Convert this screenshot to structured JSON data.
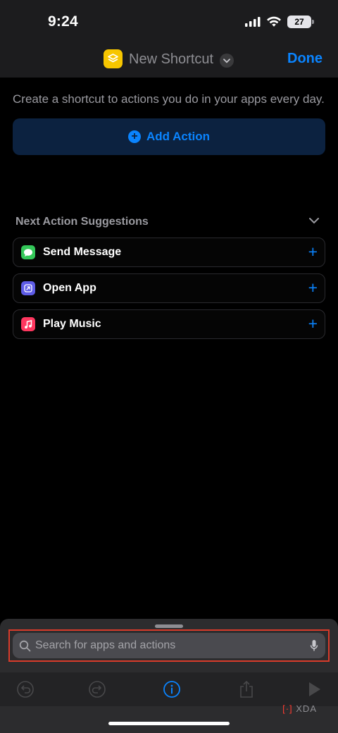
{
  "status_bar": {
    "time": "9:24",
    "battery": "27"
  },
  "nav": {
    "title": "New Shortcut",
    "done_label": "Done",
    "app_icon": "shortcuts-layers-icon"
  },
  "content": {
    "intro": "Create a shortcut to actions you do in your apps every day.",
    "add_action_label": "Add Action",
    "suggestions_title": "Next Action Suggestions",
    "suggestions": [
      {
        "label": "Send Message",
        "icon": "messages-icon",
        "color": "#34c759"
      },
      {
        "label": "Open App",
        "icon": "open-app-icon",
        "color": "#5e5ce6"
      },
      {
        "label": "Play Music",
        "icon": "music-icon",
        "color": "#ff375f"
      }
    ]
  },
  "sheet": {
    "search_placeholder": "Search for apps and actions",
    "toolbar": [
      "undo-icon",
      "redo-icon",
      "info-icon",
      "share-icon",
      "play-icon"
    ],
    "watermark": "XDA"
  },
  "colors": {
    "accent": "#0a84ff",
    "highlight": "#d93b2a"
  }
}
